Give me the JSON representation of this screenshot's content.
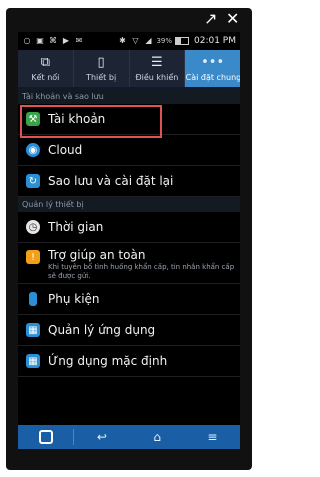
{
  "status_bar": {
    "battery_percent": "39%",
    "time": "02:01 PM"
  },
  "tabs": [
    {
      "label": "Kết nối",
      "icon": "connection-icon",
      "active": false
    },
    {
      "label": "Thiết bị",
      "icon": "phone-icon",
      "active": false
    },
    {
      "label": "Điều khiển",
      "icon": "sliders-icon",
      "active": false
    },
    {
      "label": "Cài đặt chung",
      "icon": "more-icon",
      "active": true
    }
  ],
  "sections": [
    {
      "header": "Tài khoản và sao lưu",
      "items": [
        {
          "label": "Tài khoản",
          "icon": "key-icon",
          "icon_color": "#3aa34a"
        },
        {
          "label": "Cloud",
          "icon": "cloud-icon",
          "icon_color": "#2a8fd6"
        },
        {
          "label": "Sao lưu và cài đặt lại",
          "icon": "backup-icon",
          "icon_color": "#2a8fd6"
        }
      ]
    },
    {
      "header": "Quản lý thiết bị",
      "items": [
        {
          "label": "Thời gian",
          "icon": "clock-icon",
          "icon_color": "#e6e6e6"
        },
        {
          "label": "Trợ giúp an toàn",
          "subtitle": "Khi tuyên bố tình huống khẩn cấp, tin nhắn khẩn cấp sẽ được gửi.",
          "icon": "alert-icon",
          "icon_color": "#f2a019"
        },
        {
          "label": "Phụ kiện",
          "icon": "accessory-icon",
          "icon_color": "#2a8fd6"
        },
        {
          "label": "Quản lý ứng dụng",
          "icon": "apps-icon",
          "icon_color": "#2a8fd6"
        },
        {
          "label": "Ứng dụng mặc định",
          "icon": "default-apps-icon",
          "icon_color": "#2a8fd6"
        }
      ]
    }
  ],
  "colors": {
    "accent": "#3a89c9",
    "navbar": "#1a5fa6",
    "highlight": "#e05353"
  }
}
